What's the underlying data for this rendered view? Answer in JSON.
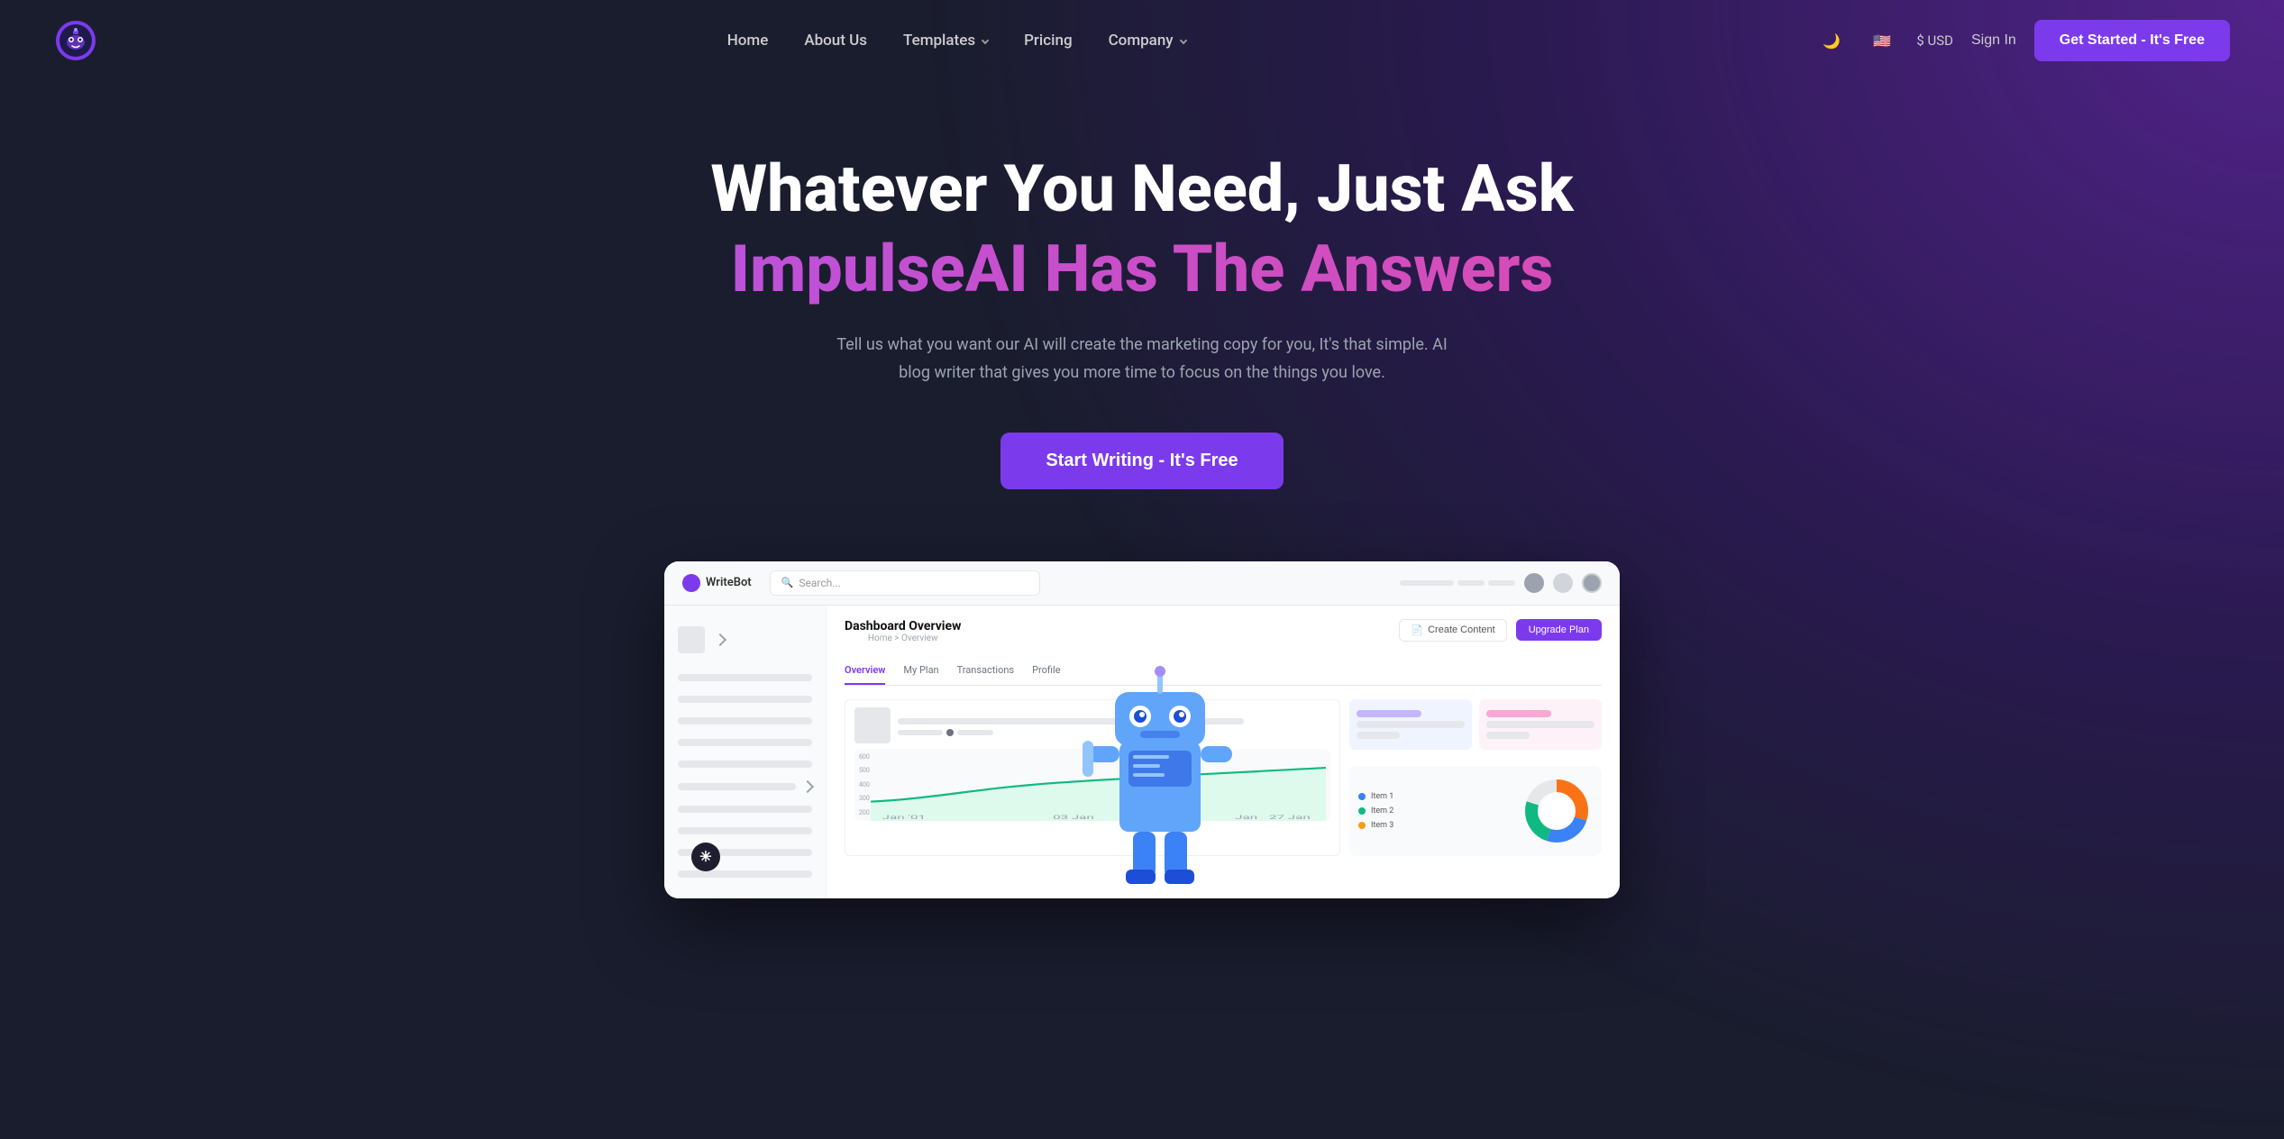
{
  "brand": {
    "name": "ImpulseAI",
    "logo_alt": "ImpulseAI Logo"
  },
  "nav": {
    "links": [
      {
        "id": "home",
        "label": "Home",
        "has_dropdown": false
      },
      {
        "id": "about",
        "label": "About Us",
        "has_dropdown": false
      },
      {
        "id": "templates",
        "label": "Templates",
        "has_dropdown": true
      },
      {
        "id": "pricing",
        "label": "Pricing",
        "has_dropdown": false
      },
      {
        "id": "company",
        "label": "Company",
        "has_dropdown": true
      }
    ],
    "currency": "$ USD",
    "sign_in": "Sign In",
    "cta": "Get Started - It's Free"
  },
  "hero": {
    "headline1": "Whatever You Need, Just Ask",
    "headline2": "ImpulseAI Has The Answers",
    "subtitle": "Tell us what you want our AI will create the marketing copy for you, It's that simple. AI blog writer that gives you more time to focus on the things you love.",
    "cta": "Start Writing - It's Free"
  },
  "dashboard": {
    "logo": "WriteBot",
    "search_placeholder": "Search...",
    "title": "Dashboard Overview",
    "breadcrumb": "Home > Overview",
    "btn_create": "Create Content",
    "btn_upgrade": "Upgrade Plan",
    "tabs": [
      "Overview",
      "My Plan",
      "Transactions",
      "Profile"
    ],
    "active_tab": "Overview",
    "chart_labels": [
      "600",
      "500",
      "400",
      "300",
      "200"
    ],
    "x_labels": [
      "Jan '01",
      "03 Jan",
      "Jan"
    ],
    "legend": [
      {
        "color": "#3b82f6",
        "label": "Item 1"
      },
      {
        "color": "#10b981",
        "label": "Item 2"
      },
      {
        "color": "#f59e0b",
        "label": "Item 3"
      }
    ],
    "donut": {
      "segments": [
        {
          "color": "#f97316",
          "value": 30
        },
        {
          "color": "#3b82f6",
          "value": 25
        },
        {
          "color": "#10b981",
          "value": 25
        },
        {
          "color": "#e5e7eb",
          "value": 20
        }
      ]
    }
  }
}
